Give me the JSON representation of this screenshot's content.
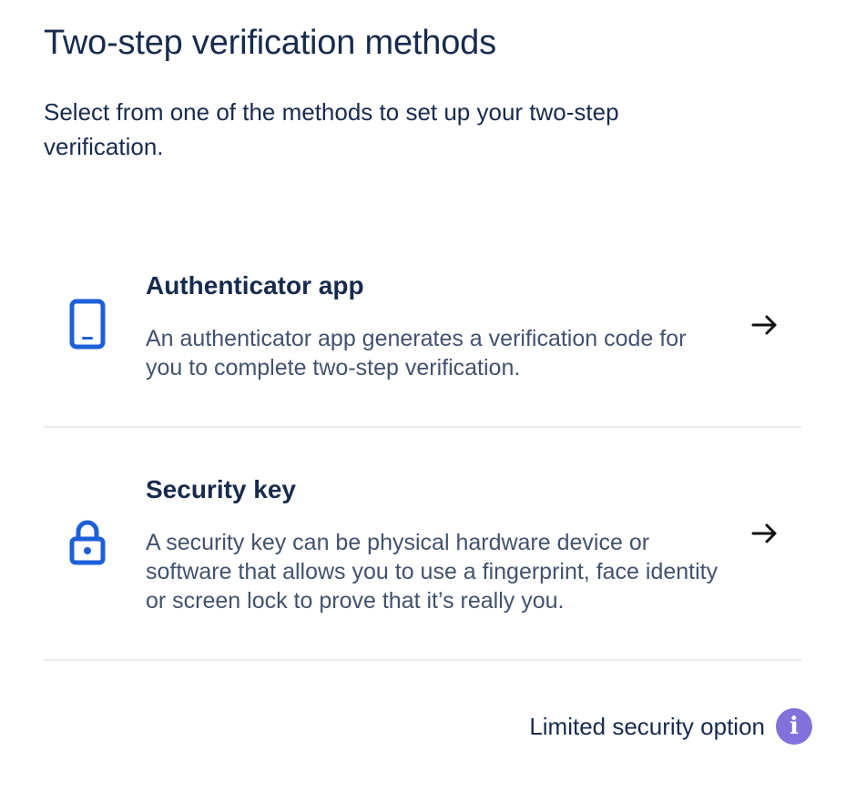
{
  "header": {
    "title": "Two-step verification methods",
    "subtitle": "Select from one of the methods to set up your two-step verification."
  },
  "methods": [
    {
      "title": "Authenticator app",
      "description": "An authenticator app generates a verification code for you to complete two-step verification.",
      "icon": "mobile-phone-icon",
      "action_icon": "arrow-right-icon"
    },
    {
      "title": "Security key",
      "description": "A security key can be physical hardware device or software that allows you to use a fingerprint, face identity or screen lock to prove that it’s really you.",
      "icon": "lock-icon",
      "action_icon": "arrow-right-icon"
    }
  ],
  "footer": {
    "limited_option_label": "Limited security option",
    "info_icon": "info-icon",
    "info_glyph": "i"
  },
  "colors": {
    "accent_blue": "#1d5fd8",
    "text_primary": "#172b4d",
    "text_secondary": "#42526e",
    "info_purple": "#8270db",
    "divider": "#ebecf0"
  }
}
